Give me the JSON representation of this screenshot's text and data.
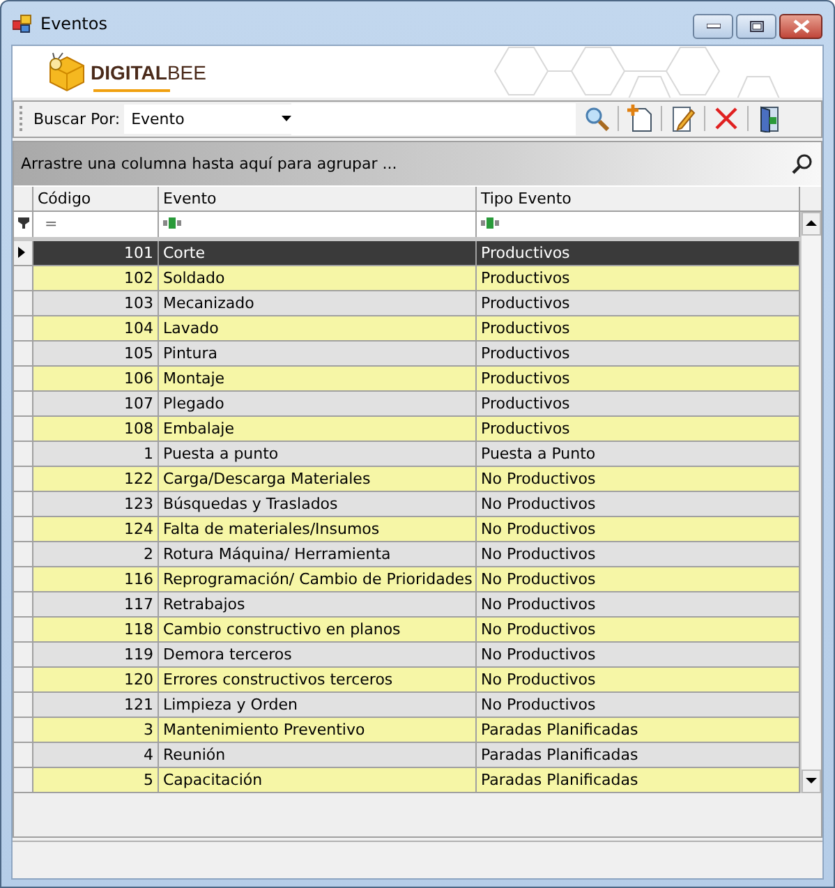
{
  "window": {
    "title": "Eventos"
  },
  "brand": {
    "logo": "**DIGITAL**BEE"
  },
  "toolbar": {
    "search_label": "Buscar Por:",
    "search_by": {
      "value": "Evento"
    }
  },
  "grid": {
    "group_hint": "Arrastre una columna hasta aquí para agrupar ...",
    "columns": [
      "Código",
      "Evento",
      "Tipo Evento"
    ],
    "filter": {
      "code_operator": "="
    },
    "rows": [
      {
        "code": "101",
        "event": "Corte",
        "type": "Productivos",
        "selected": true
      },
      {
        "code": "102",
        "event": "Soldado",
        "type": "Productivos",
        "selected": false
      },
      {
        "code": "103",
        "event": "Mecanizado",
        "type": "Productivos",
        "selected": false
      },
      {
        "code": "104",
        "event": "Lavado",
        "type": "Productivos",
        "selected": false
      },
      {
        "code": "105",
        "event": "Pintura",
        "type": "Productivos",
        "selected": false
      },
      {
        "code": "106",
        "event": "Montaje",
        "type": "Productivos",
        "selected": false
      },
      {
        "code": "107",
        "event": "Plegado",
        "type": "Productivos",
        "selected": false
      },
      {
        "code": "108",
        "event": "Embalaje",
        "type": "Productivos",
        "selected": false
      },
      {
        "code": "1",
        "event": "Puesta a punto",
        "type": "Puesta a Punto",
        "selected": false
      },
      {
        "code": "122",
        "event": "Carga/Descarga Materiales",
        "type": "No Productivos",
        "selected": false
      },
      {
        "code": "123",
        "event": "Búsquedas y Traslados",
        "type": "No Productivos",
        "selected": false
      },
      {
        "code": "124",
        "event": "Falta de materiales/Insumos",
        "type": "No Productivos",
        "selected": false
      },
      {
        "code": "2",
        "event": "Rotura Máquina/ Herramienta",
        "type": "No Productivos",
        "selected": false
      },
      {
        "code": "116",
        "event": "Reprogramación/ Cambio de Prioridades",
        "type": "No Productivos",
        "selected": false
      },
      {
        "code": "117",
        "event": "Retrabajos",
        "type": "No Productivos",
        "selected": false
      },
      {
        "code": "118",
        "event": "Cambio constructivo en planos",
        "type": "No Productivos",
        "selected": false
      },
      {
        "code": "119",
        "event": "Demora terceros",
        "type": "No Productivos",
        "selected": false
      },
      {
        "code": "120",
        "event": "Errores constructivos terceros",
        "type": "No Productivos",
        "selected": false
      },
      {
        "code": "121",
        "event": "Limpieza y Orden",
        "type": "No Productivos",
        "selected": false
      },
      {
        "code": "3",
        "event": "Mantenimiento Preventivo",
        "type": "Paradas Planificadas",
        "selected": false
      },
      {
        "code": "4",
        "event": "Reunión",
        "type": "Paradas Planificadas",
        "selected": false
      },
      {
        "code": "5",
        "event": "Capacitación",
        "type": "Paradas Planificadas",
        "selected": false
      }
    ]
  }
}
